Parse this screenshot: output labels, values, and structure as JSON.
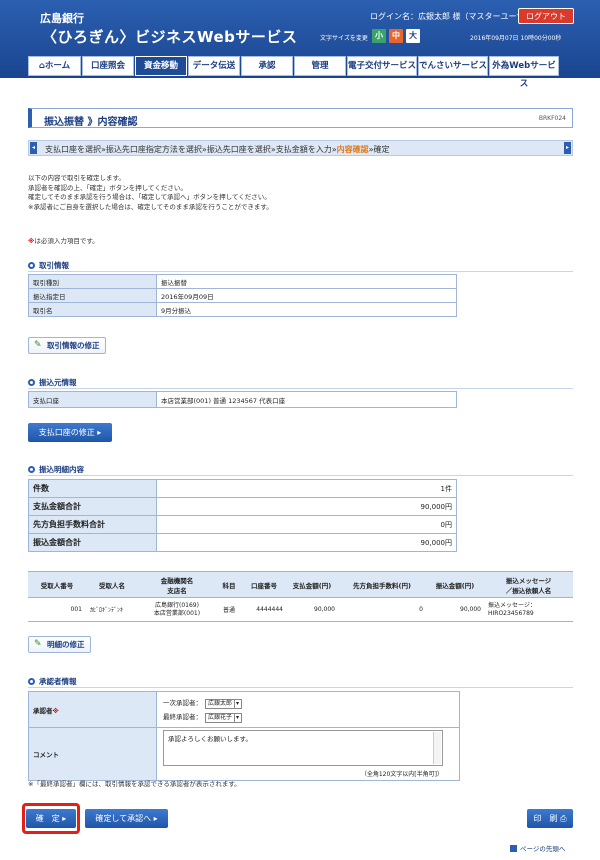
{
  "header": {
    "bank_name": "広島銀行",
    "service_name": "〈ひろぎん〉ビジネスWebサービス",
    "login_label": "ログイン名：広銀太郎 様（マスターユーザ）",
    "logout_label": "ログアウト",
    "fontsize_label": "文字サイズを変更",
    "fontsize_small": "小",
    "fontsize_medium": "中",
    "fontsize_large": "大",
    "datetime": "2016年09月07日 10時00分00秒"
  },
  "nav": [
    {
      "label": "ホーム",
      "icon": "home-icon"
    },
    {
      "label": "口座照会"
    },
    {
      "label": "資金移動",
      "active": true
    },
    {
      "label": "データ伝送"
    },
    {
      "label": "承認"
    },
    {
      "label": "管理"
    },
    {
      "label": "電子交付サービス"
    },
    {
      "label": "でんさいサービス"
    },
    {
      "label": "外為Webサービス"
    }
  ],
  "page": {
    "title": "振込振替 》内容確認",
    "code": "BRKF024",
    "steps": [
      "支払口座を選択",
      "振込先口座指定方法を選択",
      "振込先口座を選択",
      "支払金額を入力",
      "内容確認",
      "確定"
    ],
    "step_separator": "»",
    "current_step": "内容確認",
    "intro_lines": [
      "以下の内容で取引を確定します。",
      "承認者を確認の上、「確定」ボタンを押してください。",
      "確定してそのまま承認を行う場合は、「確定して承認へ」ボタンを押してください。",
      "※承認者にご自身を選択した場合は、確定してそのまま承認を行うことができます。"
    ],
    "required_mark": "※",
    "required_text": "は必須入力項目です。"
  },
  "transaction_info": {
    "heading": "取引情報",
    "rows": [
      {
        "label": "取引種別",
        "value": "振込振替"
      },
      {
        "label": "振込指定日",
        "value": "2016年09月09日"
      },
      {
        "label": "取引名",
        "value": "9月分振込"
      }
    ],
    "edit_label": "取引情報の修正"
  },
  "source_info": {
    "heading": "振込元情報",
    "label": "支払口座",
    "value": "本店営業部(001) 普通 1234567 代表口座",
    "edit_label": "支払口座の修正",
    "edit_arrow": "▸"
  },
  "detail_info": {
    "heading": "振込明細内容",
    "rows": [
      {
        "label": "件数",
        "value": "1件"
      },
      {
        "label": "支払金額合計",
        "value": "90,000円"
      },
      {
        "label": "先方負担手数料合計",
        "value": "0円"
      },
      {
        "label": "振込金額合計",
        "value": "90,000円"
      }
    ]
  },
  "detail_table": {
    "headers": [
      "受取人番号",
      "受取人名",
      "金融機関名\n支店名",
      "科目",
      "口座番号",
      "支払金額(円)",
      "先方負担手数料(円)",
      "振込金額(円)",
      "振込メッセージ\n／振込依頼人名"
    ],
    "rows": [
      {
        "number": "001",
        "name": "ｶﾋﾞﾛｷﾞﾝﾃﾞﾝｷ",
        "bank": "広島銀行(0169)",
        "branch": "本店営業部(001)",
        "subject": "普通",
        "account": "4444444",
        "payment": "90,000",
        "fee": "0",
        "amount": "90,000",
        "message": "振込メッセージ：",
        "requester": "HIRO23456789"
      }
    ],
    "edit_label": "明細の修正"
  },
  "approver_info": {
    "heading": "承認者情報",
    "approver_label": "承認者",
    "approver_mark": "※",
    "first_label": "一次承認者：",
    "first_value": "広銀太郎",
    "final_label": "最終承認者：",
    "final_value": "広銀花子",
    "comment_label": "コメント",
    "comment_value": "承認よろしくお願いします。",
    "char_limit": "（全角120文字以内[半角可]）",
    "select_arrow": "▾"
  },
  "footer": {
    "note": "※「最終承認者」欄には、取引情報を承認できる承認者が表示されます。",
    "confirm_label": "確　定",
    "confirm_approve_label": "確定して承認へ",
    "print_label": "印　刷",
    "page_top_label": "ページの先頭へ",
    "button_arrow": "▸",
    "print_icon": "⎙"
  }
}
